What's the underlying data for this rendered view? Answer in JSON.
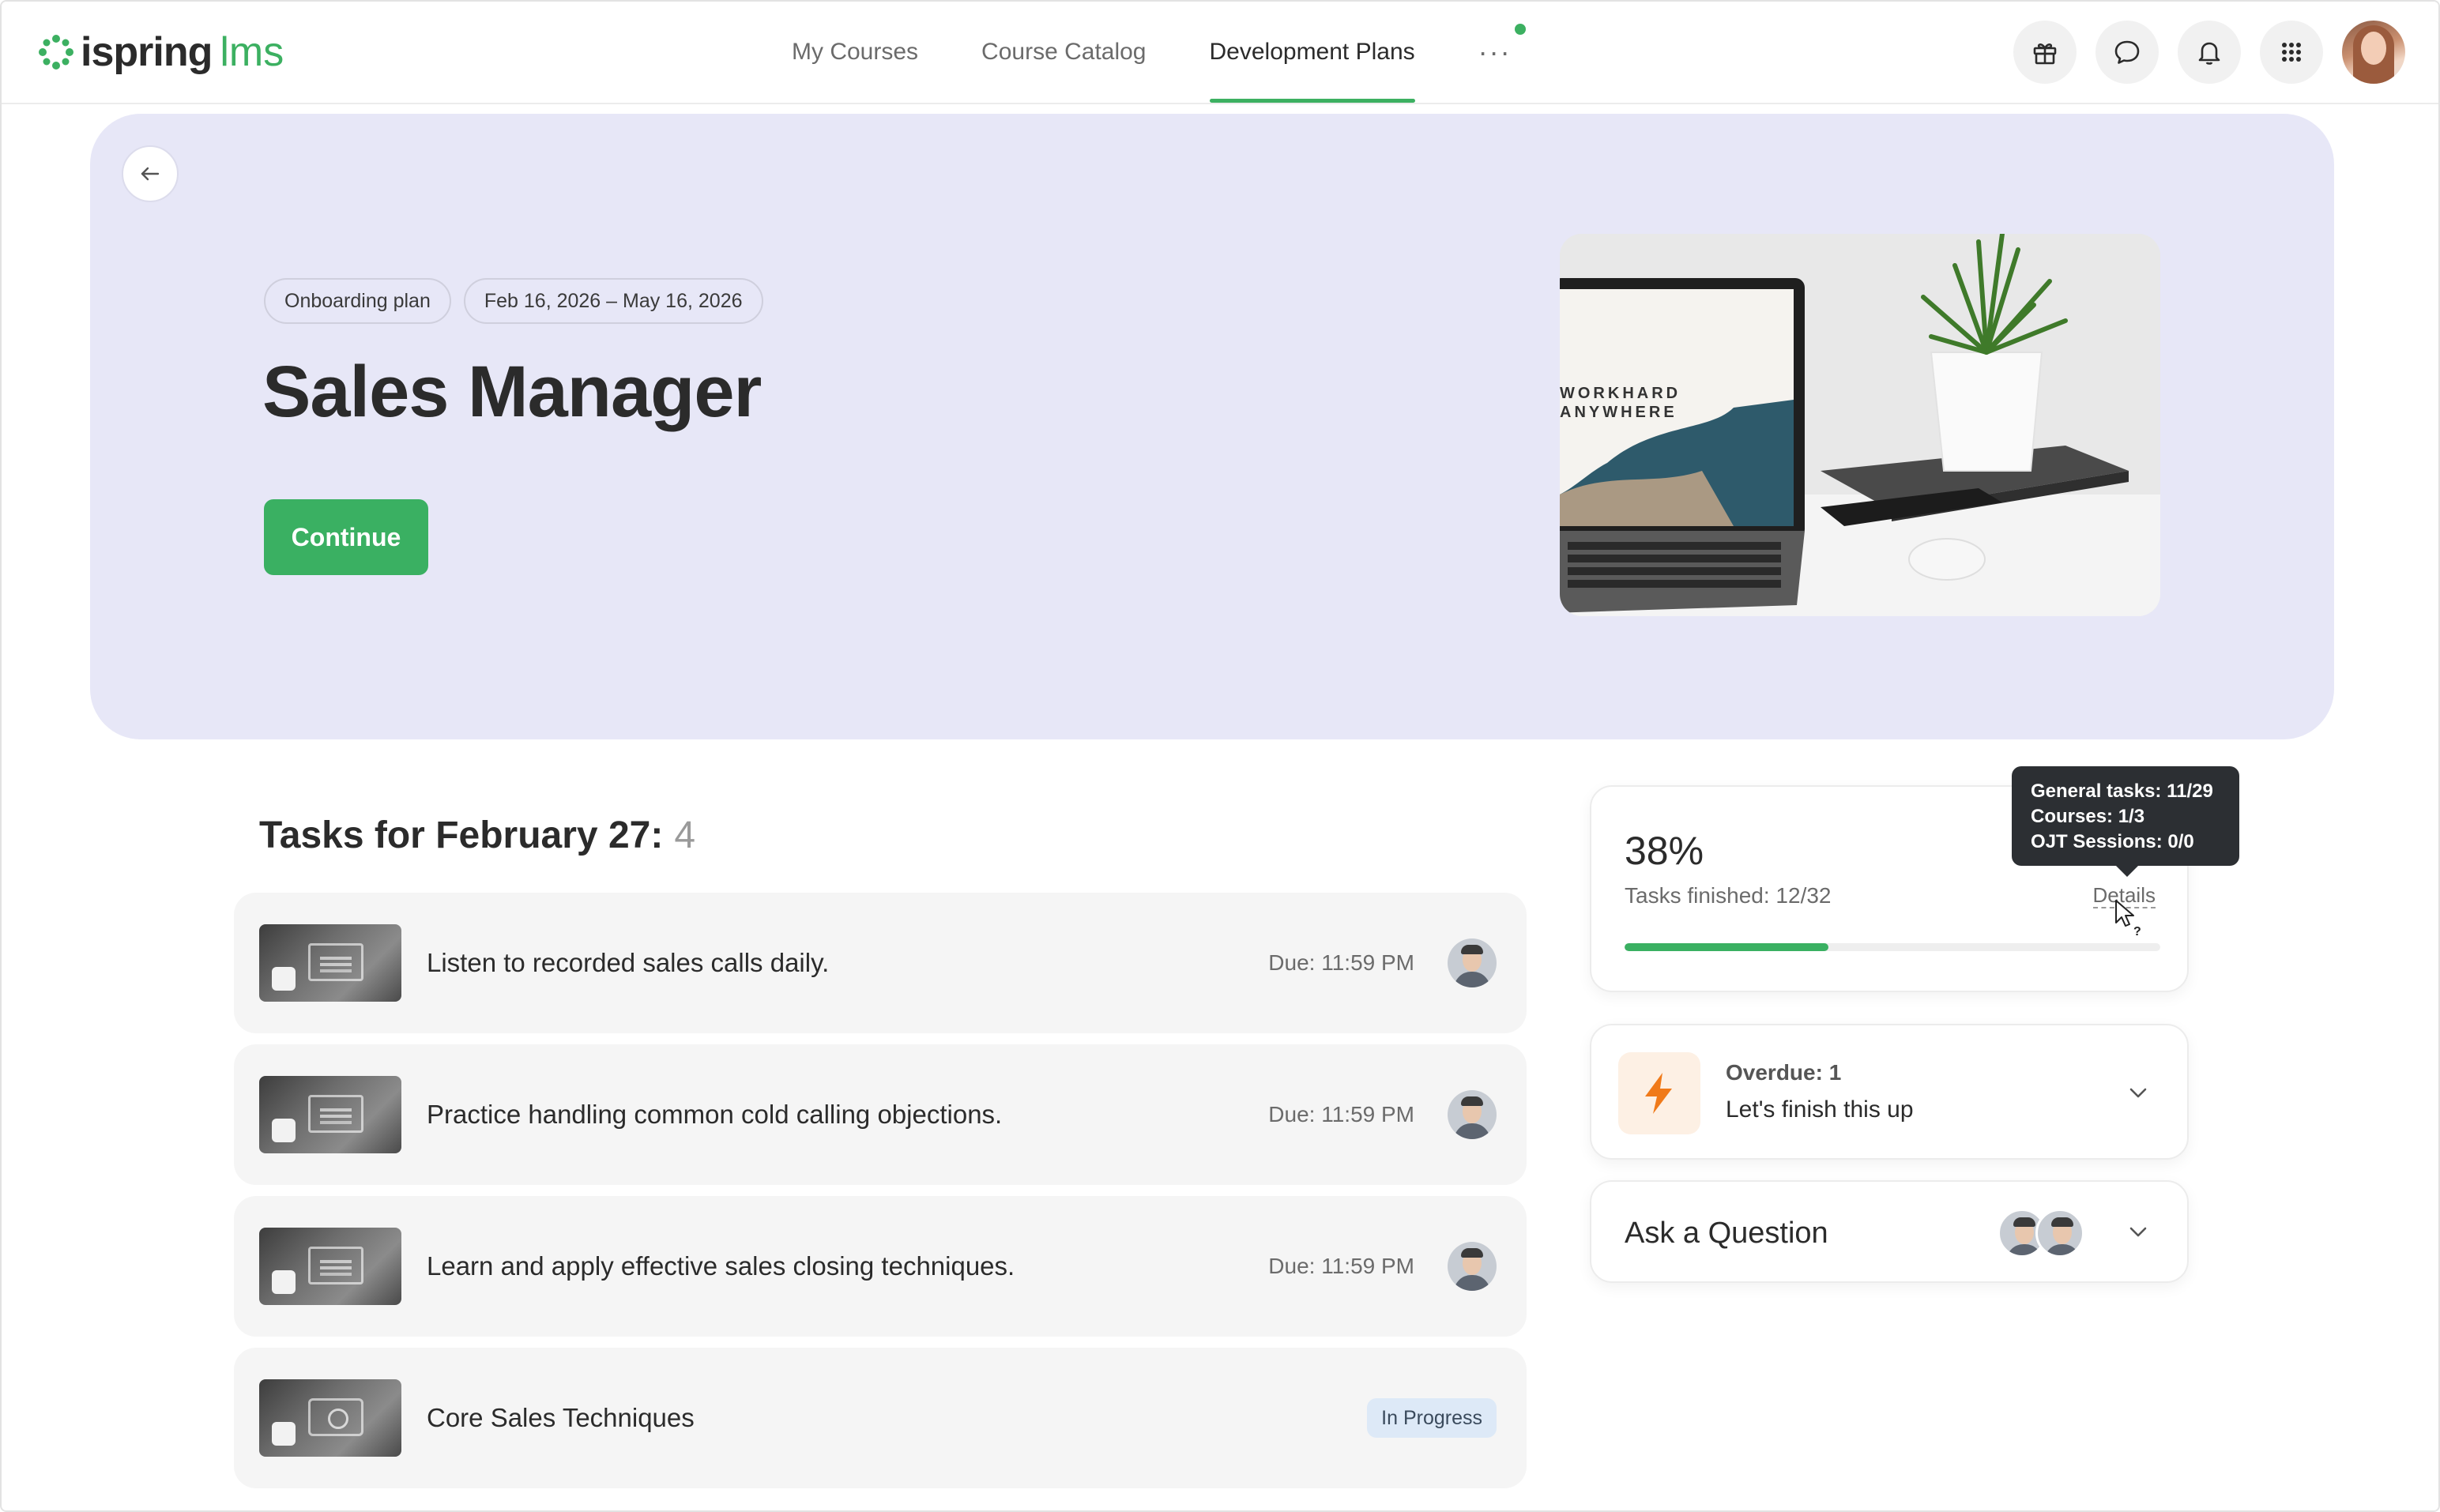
{
  "app": {
    "logo_text": "ispring",
    "logo_suffix": "lms"
  },
  "nav": {
    "items": [
      {
        "label": "My Courses",
        "active": false
      },
      {
        "label": "Course Catalog",
        "active": false
      },
      {
        "label": "Development Plans",
        "active": true
      }
    ],
    "more_label": "···",
    "accent_color": "#3cb061"
  },
  "top_icons": [
    "gift-icon",
    "chat-icon",
    "bell-icon",
    "apps-grid-icon"
  ],
  "hero": {
    "chips": [
      "Onboarding plan",
      "Feb 16, 2026 – May 16, 2026"
    ],
    "title": "Sales Manager",
    "continue_label": "Continue",
    "image_text_line1": "WORKHARD",
    "image_text_line2": "ANYWHERE",
    "background_color": "#e7e7f7"
  },
  "tasks": {
    "title": "Tasks for February 27:",
    "count": "4",
    "items": [
      {
        "label": "Listen to recorded sales calls daily.",
        "due": "Due: 11:59 PM",
        "kind": "task"
      },
      {
        "label": "Practice handling common cold calling objections.",
        "due": "Due: 11:59 PM",
        "kind": "task"
      },
      {
        "label": "Learn and apply effective sales closing techniques.",
        "due": "Due: 11:59 PM",
        "kind": "task"
      },
      {
        "label": "Core Sales Techniques",
        "status": "In Progress",
        "kind": "course"
      }
    ]
  },
  "progress": {
    "percent_label": "38%",
    "percent_value": 38,
    "finished_label": "Tasks finished: 12/32",
    "details_label": "Details",
    "tooltip": {
      "general": "General tasks: 11/29",
      "courses": "Courses: 1/3",
      "ojt": "OJT Sessions: 0/0"
    }
  },
  "overdue": {
    "title": "Overdue: 1",
    "subtitle": "Let's finish this up",
    "icon": "lightning-icon",
    "icon_color": "#f07a1a"
  },
  "ask": {
    "title": "Ask a Question"
  }
}
